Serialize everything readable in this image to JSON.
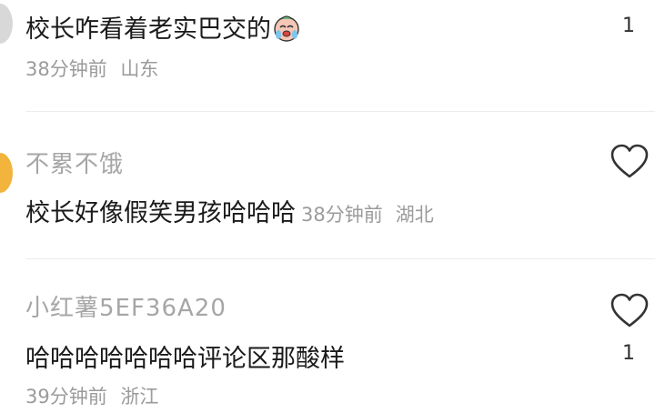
{
  "comments": [
    {
      "text": "校长咋看着老实巴交的",
      "emoji": "crying-laughing-face-icon",
      "time": "38分钟前",
      "location": "山东",
      "like_count": "1"
    },
    {
      "username": "不累不饿",
      "text": "校长好像假笑男孩哈哈哈",
      "time": "38分钟前",
      "location": "湖北"
    },
    {
      "username": "小红薯5EF36A20",
      "text": "哈哈哈哈哈哈哈评论区那酸样",
      "time": "39分钟前",
      "location": "浙江",
      "like_count": "1"
    }
  ],
  "colors": {
    "avatar_orange": "#f2b43c",
    "meta_gray": "#9b9b9b",
    "username_gray": "#a6a6a6"
  }
}
